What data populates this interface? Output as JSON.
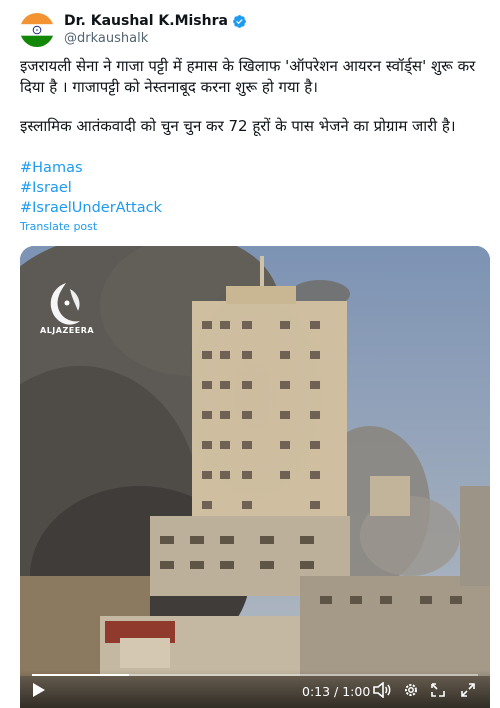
{
  "author": {
    "name": "Dr. Kaushal K.Mishra",
    "handle": "@drkaushalk",
    "verified_color": "#1d9bf0",
    "avatar_icon": "indian-flag-avatar"
  },
  "post": {
    "paragraph1": "इजरायली सेना ने गाजा पट्टी में हमास के खिलाफ 'ऑपरेशन आयरन स्वॉर्ड्स' शुरू कर दिया है । गाजापट्टी को नेस्तनाबूद करना शुरू हो गया है।",
    "paragraph2": "इस्लामिक आतंकवादी को चुन चुन कर 72 हूरों के पास भेजने का प्रोग्राम जारी है।",
    "hashtags": [
      "#Hamas",
      "#Israel",
      "#IsraelUnderAttack"
    ],
    "translate_label": "Translate post"
  },
  "media": {
    "watermark": "ALJAZEERA",
    "time_current": "0:13",
    "time_total": "1:00",
    "time_display": "0:13 / 1:00",
    "progress_fraction": 0.217
  },
  "colors": {
    "link": "#1d9bf0",
    "text": "#0f1419",
    "secondary": "#536471"
  }
}
